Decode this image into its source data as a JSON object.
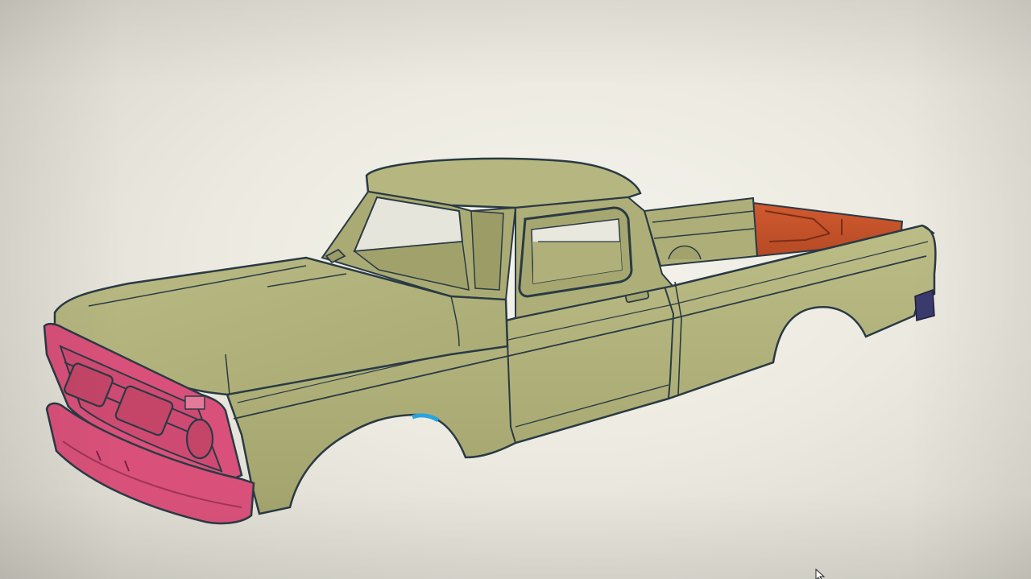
{
  "viewer": {
    "model_icon": "pickup-truck-3d-model",
    "background_color": "#ecebe2"
  },
  "model_parts": {
    "body_color": "#b3b47c",
    "body_shadow_color": "#9c9d68",
    "outline_color": "#2a3a44",
    "front_grille_bumper_color": "#d9517a",
    "bed_interior_color": "#c8582f",
    "wheel_well_accent_color": "#2aa3e0",
    "tail_light_color": "#3b3a6e"
  },
  "pointer": {
    "icon": "mouse-cursor-icon"
  }
}
